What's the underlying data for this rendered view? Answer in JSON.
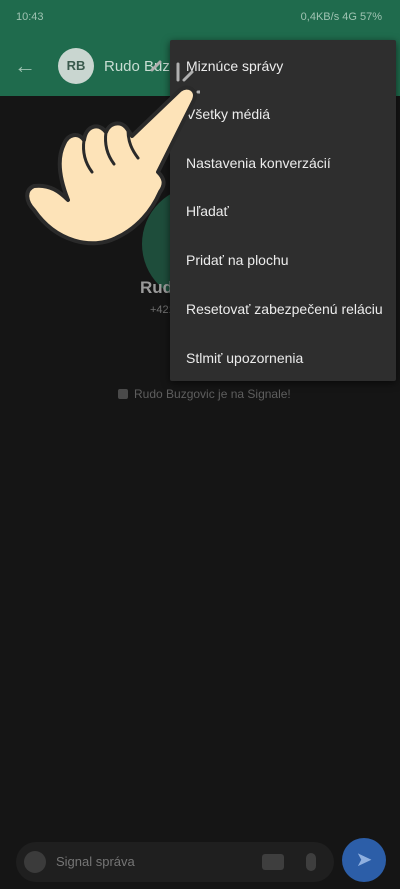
{
  "status_bar": {
    "time": "10:43",
    "right": "0,4KB/s  4G  57%"
  },
  "header": {
    "avatar_initials": "RB",
    "title": "Rudo Buzgovic"
  },
  "profile": {
    "name": "Rudo Buzgovic",
    "phone": "+421 9xx xxx xxx"
  },
  "timeline": {
    "joined_text": "Rudo Buzgovic je na Signale!"
  },
  "composer": {
    "placeholder": "Signal správa"
  },
  "menu": {
    "items": [
      {
        "label": "Miznúce správy"
      },
      {
        "label": "Všetky médiá"
      },
      {
        "label": "Nastavenia konverzácií"
      },
      {
        "label": "Hľadať"
      },
      {
        "label": "Pridať na plochu"
      },
      {
        "label": "Resetovať zabezpečenú reláciu"
      },
      {
        "label": "Stlmiť upozornenia"
      }
    ]
  },
  "colors": {
    "app_bar": "#1f6b4d",
    "menu_bg": "#2e2e2e",
    "menu_text": "#ececec",
    "send": "#2c5ea8"
  },
  "overlay": {
    "icon": "pointing-hand-icon"
  }
}
